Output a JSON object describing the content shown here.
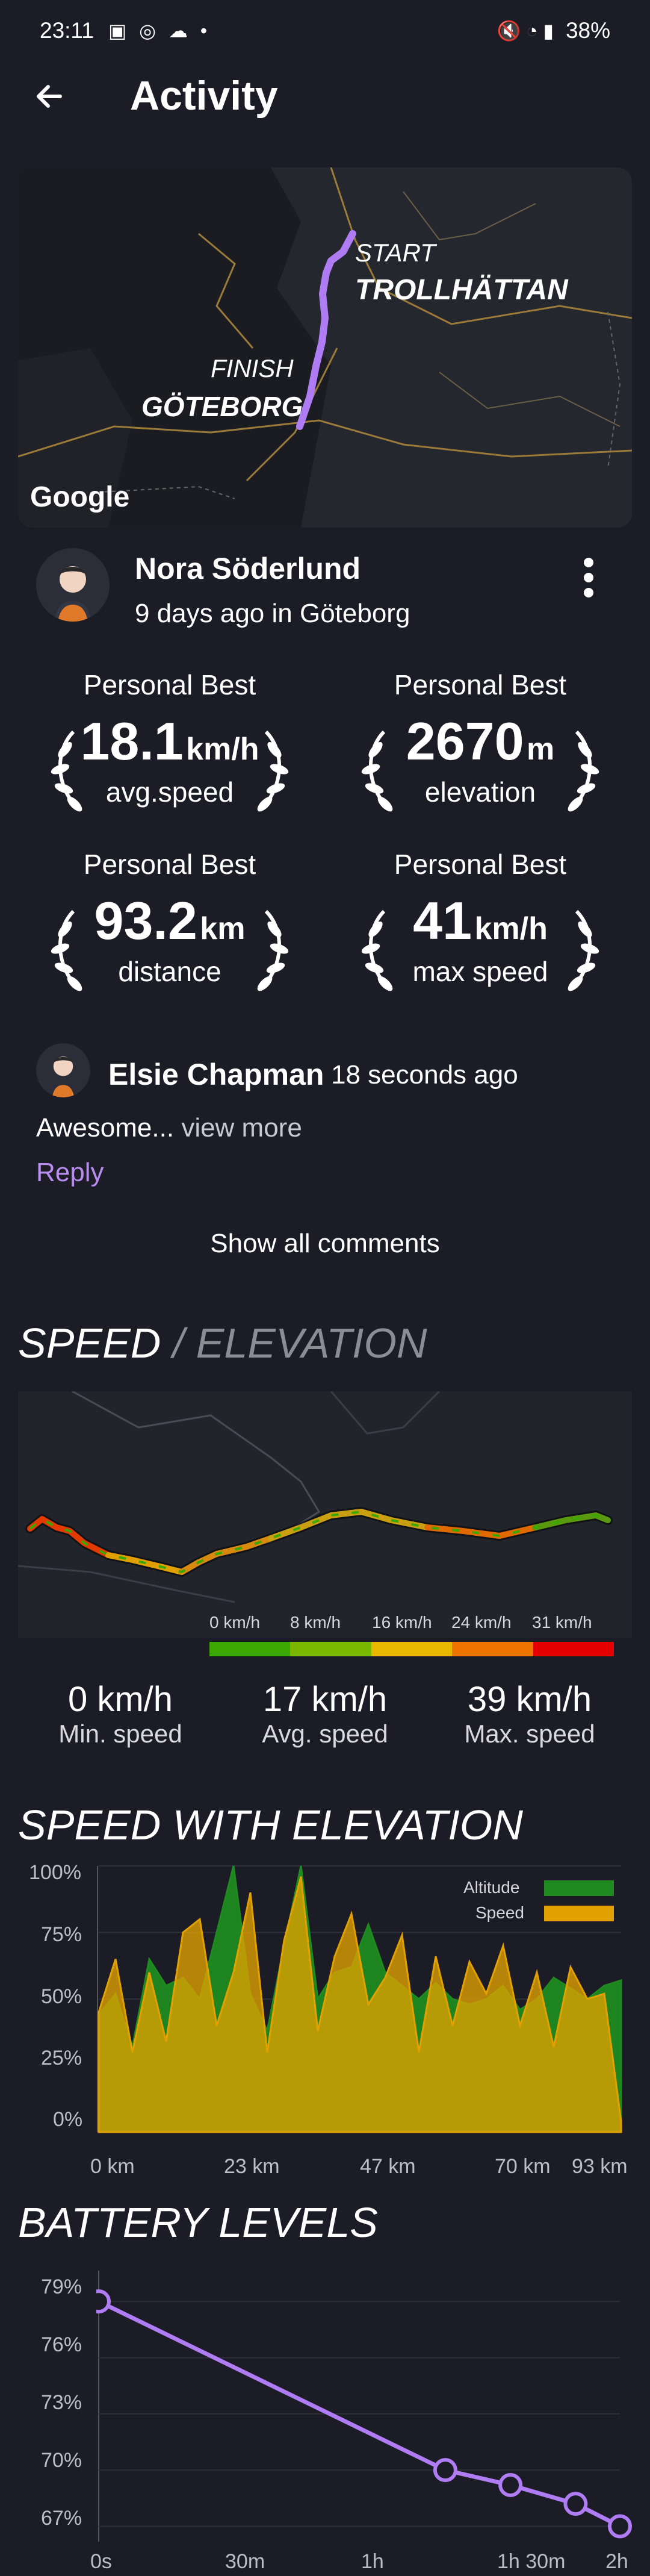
{
  "status": {
    "time": "23:11",
    "battery": "38%"
  },
  "titlebar": {
    "title": "Activity"
  },
  "map": {
    "start_label": "START",
    "start_city": "TROLLHÄTTAN",
    "finish_label": "FINISH",
    "finish_city": "GÖTEBORG",
    "provider": "Google"
  },
  "user": {
    "name": "Nora Söderlund",
    "when": "9 days ago in Göteborg"
  },
  "personal_bests": [
    {
      "head": "Personal Best",
      "value": "18.1",
      "unit": "km/h",
      "label": "avg.speed"
    },
    {
      "head": "Personal Best",
      "value": "2670",
      "unit": "m",
      "label": "elevation"
    },
    {
      "head": "Personal Best",
      "value": "93.2",
      "unit": "km",
      "label": "distance"
    },
    {
      "head": "Personal Best",
      "value": "41",
      "unit": "km/h",
      "label": "max speed"
    }
  ],
  "comment": {
    "author": "Elsie Chapman",
    "time": "18 seconds ago",
    "text": "Awesome...",
    "more": "view more",
    "reply": "Reply",
    "show_all": "Show all comments"
  },
  "speed_elevation": {
    "title_speed": "SPEED",
    "title_sep": " / ",
    "title_elev": "ELEVATION",
    "legend": [
      "0 km/h",
      "8 km/h",
      "16 km/h",
      "24 km/h",
      "31 km/h"
    ],
    "legend_colors": [
      "#3aa800",
      "#7bb800",
      "#e9b800",
      "#f07400",
      "#e40000"
    ],
    "stats": [
      {
        "value": "0 km/h",
        "label": "Min. speed"
      },
      {
        "value": "17 km/h",
        "label": "Avg. speed"
      },
      {
        "value": "39 km/h",
        "label": "Max. speed"
      }
    ]
  },
  "speed_with_elevation": {
    "title": "SPEED WITH ELEVATION",
    "legend": [
      {
        "name": "Altitude",
        "color": "#1f8a1f"
      },
      {
        "name": "Speed",
        "color": "#e2a100"
      }
    ],
    "y_ticks": [
      "100%",
      "75%",
      "50%",
      "25%",
      "0%"
    ],
    "x_ticks": [
      "0 km",
      "23 km",
      "47 km",
      "70 km",
      "93 km"
    ]
  },
  "battery": {
    "title": "BATTERY LEVELS",
    "y_ticks": [
      "79%",
      "76%",
      "73%",
      "70%",
      "67%"
    ],
    "x_ticks": [
      "0s",
      "30m",
      "1h",
      "1h 30m",
      "2h"
    ]
  },
  "chart_data": [
    {
      "type": "area",
      "title": "SPEED WITH ELEVATION",
      "x_ticks": [
        "0 km",
        "23 km",
        "47 km",
        "70 km",
        "93 km"
      ],
      "ylim": [
        0,
        100
      ],
      "series": [
        {
          "name": "Altitude",
          "values": [
            44,
            52,
            32,
            65,
            55,
            58,
            50,
            75,
            100,
            52,
            38,
            70,
            100,
            50,
            60,
            62,
            78,
            60,
            55,
            50,
            56,
            50,
            48,
            50,
            55,
            46,
            50,
            58,
            54,
            50,
            55,
            57
          ]
        },
        {
          "name": "Speed",
          "values": [
            45,
            65,
            30,
            60,
            34,
            75,
            80,
            40,
            60,
            90,
            30,
            72,
            96,
            38,
            66,
            82,
            48,
            58,
            74,
            30,
            66,
            40,
            64,
            52,
            70,
            40,
            60,
            32,
            62,
            50,
            52,
            4
          ]
        }
      ]
    },
    {
      "type": "line",
      "title": "BATTERY LEVELS",
      "x": [
        "0s",
        "1h 20m",
        "1h 35m",
        "1h 50m",
        "2h"
      ],
      "values": [
        79,
        70,
        69.2,
        68.2,
        67
      ],
      "ylim": [
        66.5,
        80
      ]
    }
  ]
}
